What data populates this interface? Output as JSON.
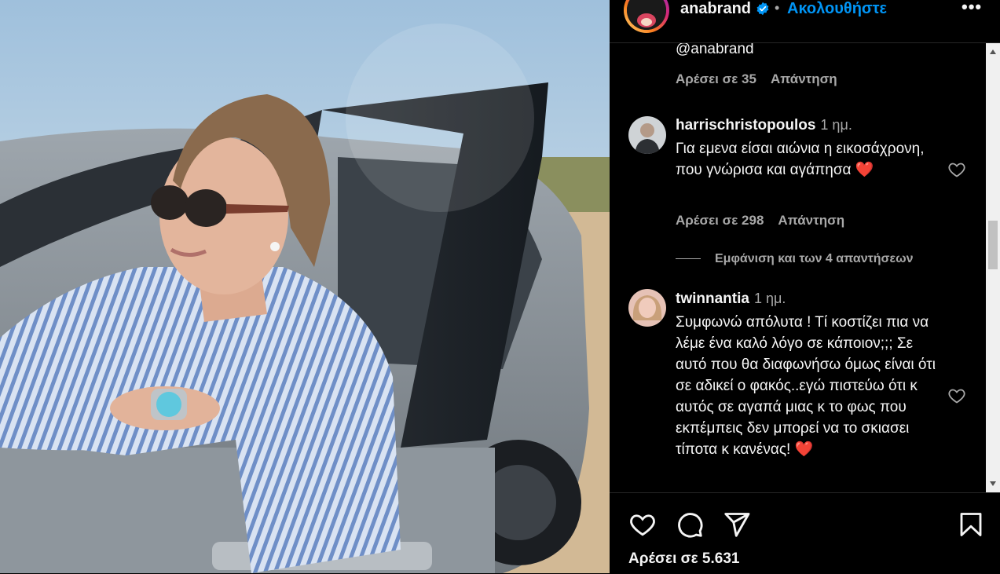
{
  "post": {
    "username": "anabrand",
    "follow_label": "Ακολουθήστε",
    "separator": "•",
    "more_label": "•••"
  },
  "comments_section": {
    "reply_to_previous": {
      "mention": "@anabrand",
      "likes_label": "Αρέσει σε 35",
      "reply_label": "Απάντηση"
    },
    "comments": [
      {
        "username": "harrischristopoulos",
        "time": "1 ημ.",
        "text": "Για εμενα είσαι αιώνια η εικοσάχρονη, που γνώρισα και αγάπησα ❤️",
        "likes_label": "Αρέσει σε 298",
        "reply_label": "Απάντηση"
      },
      {
        "username": "twinnantia",
        "time": "1 ημ.",
        "text": "Συμφωνώ απόλυτα ! Τί κοστίζει πια να λέμε ένα καλό λόγο σε κάποιον;;; Σε αυτό που θα διαφωνήσω όμως είναι ότι σε αδικεί ο φακός..εγώ πιστεύω ότι κ αυτός σε αγαπά μιας κ το φως που εκπέμπεις δεν μπορεί να το σκιασει τίποτα κ κανένας! ❤️"
      }
    ],
    "view_replies_label": "Εμφάνιση και των 4 απαντήσεων"
  },
  "footer": {
    "likes_label": "Αρέσει σε 5.631"
  },
  "icons": {
    "like": "heart-icon",
    "comment": "comment-icon",
    "share": "share-icon",
    "save": "bookmark-icon",
    "verified": "verified-badge-icon"
  },
  "colors": {
    "background": "#000000",
    "link_blue": "#0095f6",
    "secondary_text": "#a8a8a8",
    "verified_blue": "#0095f6",
    "heart_red": "#e0262f"
  }
}
